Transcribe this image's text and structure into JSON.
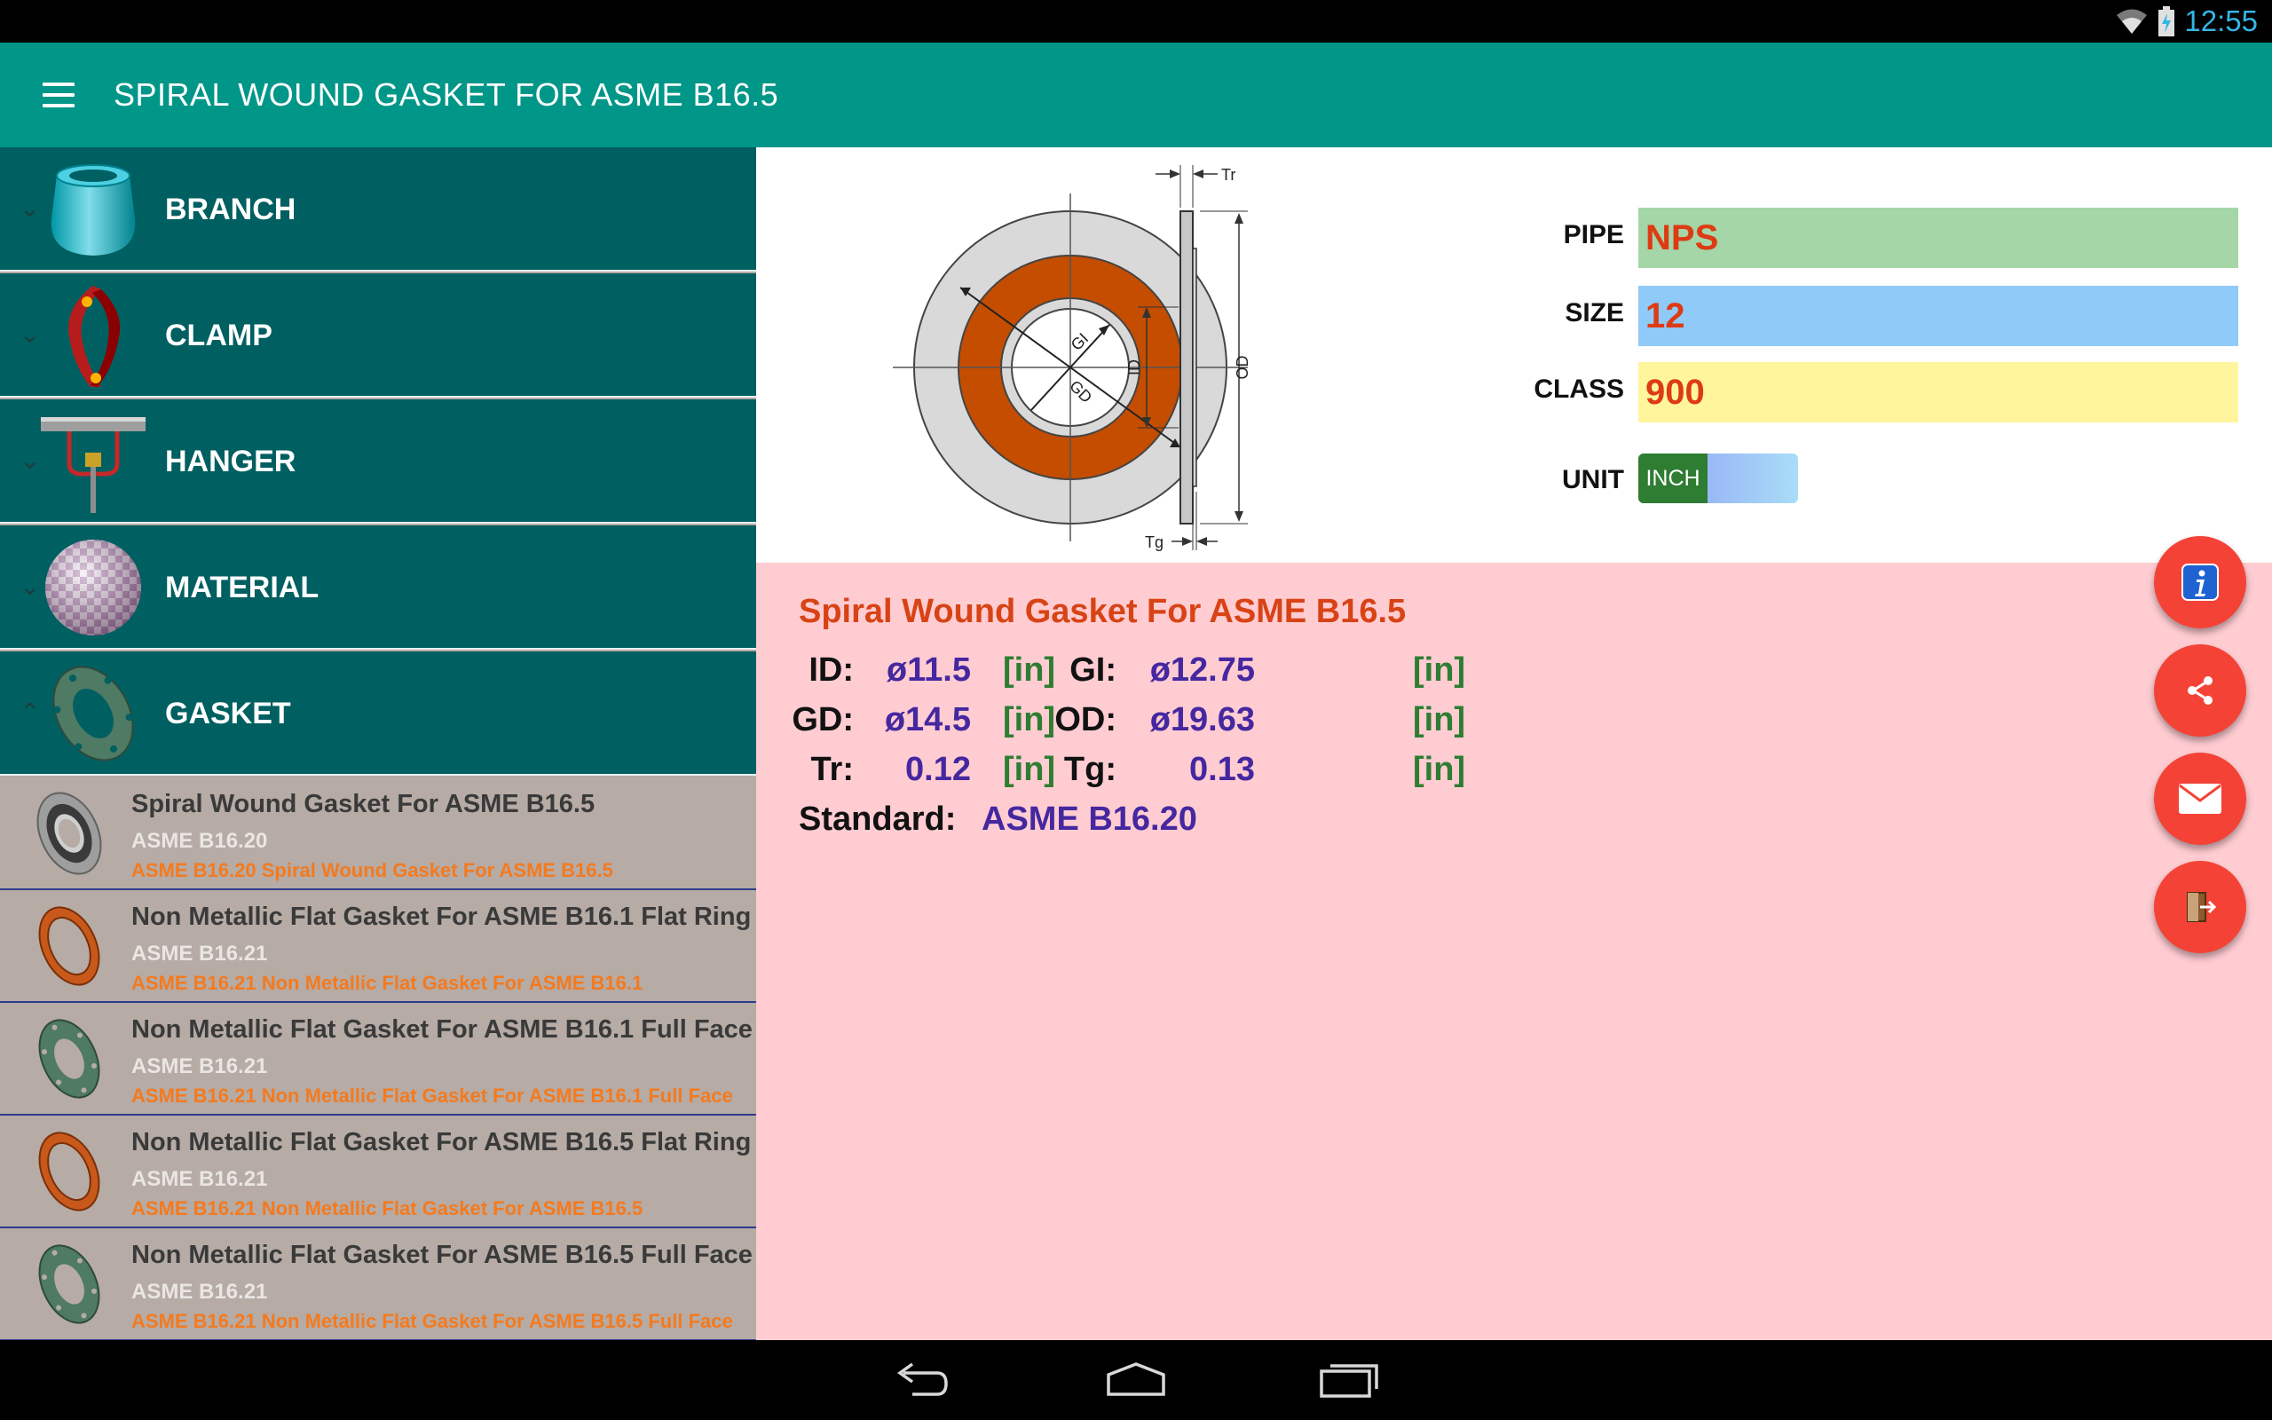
{
  "status_bar": {
    "time": "12:55"
  },
  "app_bar": {
    "title": "SPIRAL WOUND GASKET FOR ASME B16.5"
  },
  "drawer": {
    "categories": [
      {
        "label": "BRANCH"
      },
      {
        "label": "CLAMP"
      },
      {
        "label": "HANGER"
      },
      {
        "label": "MATERIAL"
      },
      {
        "label": "GASKET"
      }
    ],
    "gasket_items": [
      {
        "title": "Spiral Wound Gasket For ASME B16.5",
        "standard": "ASME B16.20",
        "description": "ASME B16.20 Spiral Wound Gasket For ASME B16.5"
      },
      {
        "title": "Non Metallic Flat Gasket For ASME B16.1 Flat Ring",
        "standard": "ASME B16.21",
        "description": "ASME B16.21 Non Metallic Flat Gasket For ASME B16.1"
      },
      {
        "title": "Non Metallic Flat Gasket For ASME B16.1 Full Face",
        "standard": "ASME B16.21",
        "description": "ASME B16.21 Non Metallic Flat Gasket For ASME B16.1 Full Face"
      },
      {
        "title": "Non Metallic Flat Gasket For ASME B16.5 Flat Ring",
        "standard": "ASME B16.21",
        "description": "ASME B16.21 Non Metallic Flat Gasket For ASME B16.5"
      },
      {
        "title": "Non Metallic Flat Gasket For ASME B16.5 Full Face",
        "standard": "ASME B16.21",
        "description": "ASME B16.21 Non Metallic Flat Gasket For ASME B16.5 Full Face"
      }
    ]
  },
  "diagram": {
    "labels": {
      "gi": "GI",
      "gd": "GD",
      "id": "ID",
      "od": "OD",
      "tr": "Tr",
      "tg": "Tg"
    }
  },
  "params": {
    "pipe": {
      "label": "PIPE",
      "value": "NPS"
    },
    "size": {
      "label": "SIZE",
      "value": "12"
    },
    "class": {
      "label": "CLASS",
      "value": "900"
    },
    "unit": {
      "label": "UNIT",
      "value": "INCH"
    }
  },
  "results": {
    "title": "Spiral Wound Gasket For ASME B16.5",
    "id": {
      "label": "ID:",
      "value": "ø11.5",
      "unit": "[in]"
    },
    "gi": {
      "label": "GI:",
      "value": "ø12.75",
      "unit": "[in]"
    },
    "gd": {
      "label": "GD:",
      "value": "ø14.5",
      "unit": "[in]"
    },
    "od": {
      "label": "OD:",
      "value": "ø19.63",
      "unit": "[in]"
    },
    "tr": {
      "label": "Tr:",
      "value": "0.12",
      "unit": "[in]"
    },
    "tg": {
      "label": "Tg:",
      "value": "0.13",
      "unit": "[in]"
    },
    "standard": {
      "label": "Standard:",
      "value": "ASME B16.20"
    }
  },
  "colors": {
    "app_bar": "#009688",
    "drawer_category": "#005f61",
    "pipe_field": "#a5d6a7",
    "size_field": "#90caf9",
    "class_field": "#fff59d",
    "result_panel": "#ffccd2",
    "fab": "#f44336"
  },
  "icons": {
    "menu": "hamburger-menu-icon",
    "info": "info-icon",
    "share": "share-icon",
    "email": "email-icon",
    "exit": "exit-icon"
  }
}
